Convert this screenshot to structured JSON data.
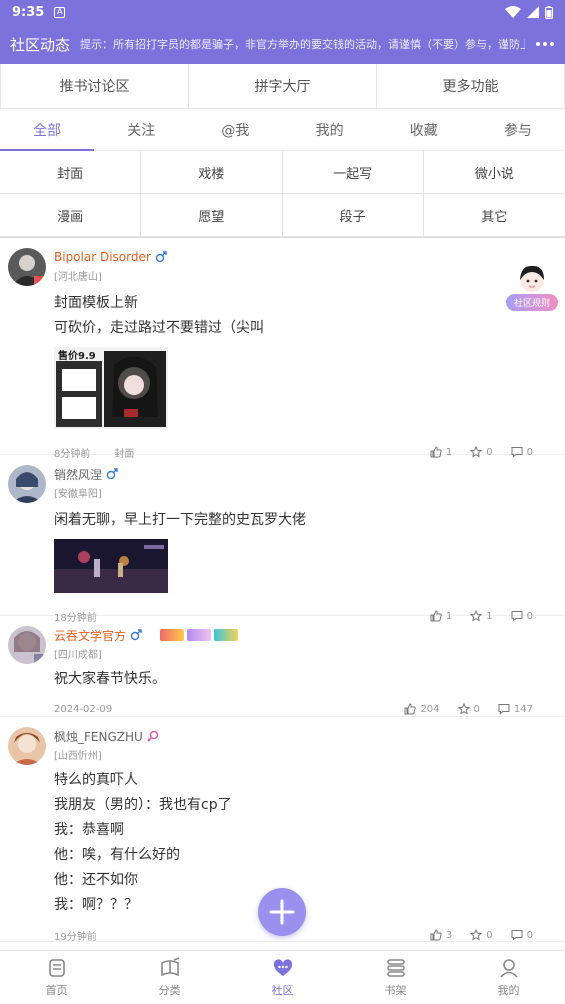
{
  "status": {
    "time": "9:35",
    "a_icon": "A"
  },
  "appbar": {
    "title": "社区动态",
    "notice": "提示：所有招打字员的都是骗子，非官方举办的要交钱的活动，请谨慎（不要）参与，谨防上当受骗"
  },
  "topnav": [
    "推书讨论区",
    "拼字大厅",
    "更多功能"
  ],
  "tabs": [
    "全部",
    "关注",
    "@我",
    "我的",
    "收藏",
    "参与"
  ],
  "categories": [
    "封面",
    "戏楼",
    "一起写",
    "微小说",
    "漫画",
    "愿望",
    "段子",
    "其它"
  ],
  "rules_label": "社区规则",
  "posts": [
    {
      "name": "Bipolar Disorder",
      "gender": "male",
      "location": "[河北唐山]",
      "lines": [
        "封面模板上新",
        "可砍价，走过路过不要错过（尖叫"
      ],
      "image_text": "售价9.9",
      "time": "8分钟前",
      "category": "封面",
      "likes": "1",
      "stars": "0",
      "comments": "0"
    },
    {
      "name": "销然风涅",
      "gender": "male",
      "location": "[安徽阜阳]",
      "lines": [
        "闲着无聊，早上打一下完整的史瓦罗大佬"
      ],
      "time": "18分钟前",
      "category": "",
      "likes": "1",
      "stars": "1",
      "comments": "0"
    },
    {
      "name": "云吞文学官方",
      "gender": "male",
      "location": "[四川成都]",
      "lines": [
        "祝大家春节快乐。"
      ],
      "time": "2024-02-09",
      "category": "",
      "likes": "204",
      "stars": "0",
      "comments": "147"
    },
    {
      "name": "枫烛_FENGZHU",
      "gender": "female",
      "location": "[山西忻州]",
      "lines": [
        "特么的真吓人",
        "我朋友（男的）：我也有cp了",
        "我：恭喜啊",
        "他：唉，有什么好的",
        "他：还不如你",
        "我：啊？？？"
      ],
      "time": "19分钟前",
      "category": "",
      "likes": "3",
      "stars": "0",
      "comments": "0"
    }
  ],
  "bottomnav": [
    {
      "label": "首页",
      "icon": "home-icon"
    },
    {
      "label": "分类",
      "icon": "category-icon"
    },
    {
      "label": "社区",
      "icon": "community-icon"
    },
    {
      "label": "书架",
      "icon": "bookshelf-icon"
    },
    {
      "label": "我的",
      "icon": "profile-icon"
    }
  ],
  "colors": {
    "accent": "#7c72dc",
    "orange_name": "#e0611f",
    "male": "#3a7bd5",
    "female": "#d65db1"
  }
}
